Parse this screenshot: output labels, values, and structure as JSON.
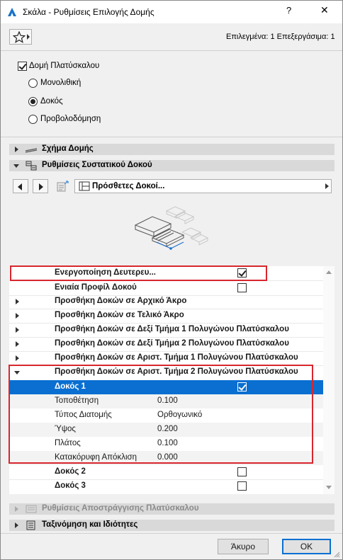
{
  "window": {
    "title": "Σκάλα - Ρυθμίσεις Επιλογής Δομής",
    "help": "?",
    "close": "✕"
  },
  "toolbar": {
    "selection_info": "Επιλεγμένα: 1 Επεξεργάσιμα: 1"
  },
  "structure": {
    "checkbox_label": "Δομή Πλατύσκαλου",
    "checked": true,
    "options": [
      {
        "label": "Μονολιθική",
        "selected": false
      },
      {
        "label": "Δοκός",
        "selected": true
      },
      {
        "label": "Προβολοδόμηση",
        "selected": false
      }
    ]
  },
  "panels": {
    "schema": "Σχήμα Δομής",
    "beam_settings": "Ρυθμίσεις Συστατικού Δοκού",
    "drainage": "Ρυθμίσεις Αποστράγγισης Πλατύσκαλου",
    "classification": "Ταξινόμηση και Ιδιότητες"
  },
  "navigator": {
    "dropdown_value": "Πρόσθετες Δοκοί..."
  },
  "tree": {
    "rows": [
      {
        "label": "Ενεργοποίηση Δευτερευ...",
        "value": "",
        "checkbox": true,
        "checked": true
      },
      {
        "label": "Ενιαία Προφίλ Δοκού",
        "value": "",
        "checkbox": true,
        "checked": false
      },
      {
        "label": "Προσθήκη Δοκών σε Αρχικό Άκρο",
        "value": ""
      },
      {
        "label": "Προσθήκη Δοκών σε Τελικό Άκρο",
        "value": ""
      },
      {
        "label": "Προσθήκη Δοκών σε Δεξί Τμήμα 1 Πολυγώνου Πλατύσκαλου",
        "value": ""
      },
      {
        "label": "Προσθήκη Δοκών σε Δεξί Τμήμα 2 Πολυγώνου Πλατύσκαλου",
        "value": ""
      },
      {
        "label": "Προσθήκη Δοκών σε Αριστ. Τμήμα 1 Πολυγώνου Πλατύσκαλου",
        "value": ""
      },
      {
        "label": "Προσθήκη Δοκών σε Αριστ. Τμήμα 2 Πολυγώνου Πλατύσκαλου",
        "value": ""
      },
      {
        "label": "Δοκός 1",
        "value": "",
        "checkbox": true,
        "checked": true
      },
      {
        "label": "Τοποθέτηση",
        "value": "0.100"
      },
      {
        "label": "Τύπος Διατομής",
        "value": "Ορθογωνικό"
      },
      {
        "label": "Ύψος",
        "value": "0.200"
      },
      {
        "label": "Πλάτος",
        "value": "0.100"
      },
      {
        "label": "Κατακόρυφη Απόκλιση",
        "value": "0.000"
      },
      {
        "label": "Δοκός 2",
        "value": "",
        "checkbox": true,
        "checked": false
      },
      {
        "label": "Δοκός 3",
        "value": "",
        "checkbox": true,
        "checked": false
      }
    ]
  },
  "buttons": {
    "cancel": "Άκυρο",
    "ok": "OK"
  },
  "colors": {
    "selection": "#0a6fd1",
    "highlight_border": "#d8262e",
    "panel_header": "#d9d9d9"
  },
  "icons": [
    "archicad-app-icon",
    "favorites-star-icon",
    "structure-scheme-icon",
    "beam-component-icon",
    "drainage-icon",
    "classification-icon",
    "beam-preview-icon"
  ]
}
